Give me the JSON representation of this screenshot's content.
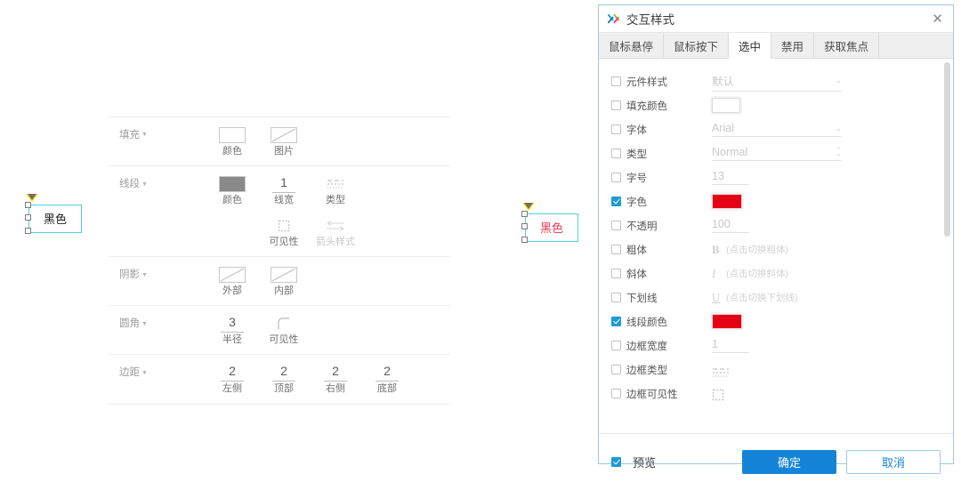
{
  "left_widget": {
    "label": "黑色",
    "text_color": "#1a1a1a",
    "selection_color": "#4fd2d8"
  },
  "right_widget": {
    "label": "黑色",
    "text_color": "#e8384f",
    "selection_color": "#4fd2d8"
  },
  "style_panel": {
    "rows": [
      {
        "label": "填充",
        "lines": [
          [
            {
              "caption": "颜色",
              "icon": "rect-swatch-icon",
              "kind": "swatch-white"
            },
            {
              "caption": "图片",
              "icon": "image-icon",
              "kind": "image"
            }
          ]
        ]
      },
      {
        "label": "线段",
        "lines": [
          [
            {
              "caption": "颜色",
              "icon": "line-color-swatch-icon",
              "kind": "swatch-gray"
            },
            {
              "caption": "线宽",
              "icon": "line-width-icon",
              "kind": "number",
              "value": "1"
            },
            {
              "caption": "类型",
              "icon": "line-type-icon",
              "kind": "dash"
            }
          ],
          [
            {
              "caption": "可见性",
              "icon": "visibility-icon",
              "kind": "visbox",
              "offset": 1
            },
            {
              "caption": "箭头样式",
              "icon": "arrow-style-icon",
              "kind": "arrow",
              "dim": true
            }
          ]
        ]
      },
      {
        "label": "阴影",
        "lines": [
          [
            {
              "caption": "外部",
              "icon": "outer-shadow-icon",
              "kind": "image"
            },
            {
              "caption": "内部",
              "icon": "inner-shadow-icon",
              "kind": "image"
            }
          ]
        ]
      },
      {
        "label": "圆角",
        "lines": [
          [
            {
              "caption": "半径",
              "icon": "corner-radius-icon",
              "kind": "number",
              "value": "3"
            },
            {
              "caption": "可见性",
              "icon": "corner-visibility-icon",
              "kind": "corner"
            }
          ]
        ]
      },
      {
        "label": "边距",
        "lines": [
          [
            {
              "caption": "左侧",
              "icon": "padding-left-icon",
              "kind": "number",
              "value": "2"
            },
            {
              "caption": "顶部",
              "icon": "padding-top-icon",
              "kind": "number",
              "value": "2"
            },
            {
              "caption": "右侧",
              "icon": "padding-right-icon",
              "kind": "number",
              "value": "2"
            },
            {
              "caption": "底部",
              "icon": "padding-bottom-icon",
              "kind": "number",
              "value": "2"
            }
          ]
        ]
      }
    ]
  },
  "dialog": {
    "title": "交互样式",
    "close_label": "✕",
    "tabs": [
      {
        "label": "鼠标悬停",
        "active": false
      },
      {
        "label": "鼠标按下",
        "active": false
      },
      {
        "label": "选中",
        "active": true
      },
      {
        "label": "禁用",
        "active": false
      },
      {
        "label": "获取焦点",
        "active": false
      }
    ],
    "accent_color": "#1584d8",
    "red_color": "#e60013",
    "rows": [
      {
        "label": "元件样式",
        "checked": false,
        "control": "select",
        "value": "默认"
      },
      {
        "label": "填充颜色",
        "checked": false,
        "control": "swatch-empty",
        "value": ""
      },
      {
        "label": "字体",
        "checked": false,
        "control": "select",
        "value": "Arial"
      },
      {
        "label": "类型",
        "checked": false,
        "control": "spinner",
        "value": "Normal"
      },
      {
        "label": "字号",
        "checked": false,
        "control": "number",
        "value": "13"
      },
      {
        "label": "字色",
        "checked": true,
        "control": "swatch-red",
        "value": "#e60013"
      },
      {
        "label": "不透明",
        "checked": false,
        "control": "number",
        "value": "100"
      },
      {
        "label": "粗体",
        "checked": false,
        "control": "toggle-bold",
        "glyph": "B",
        "hint": "(点击切换粗体)"
      },
      {
        "label": "斜体",
        "checked": false,
        "control": "toggle-italic",
        "glyph": "I",
        "hint": "(点击切换斜体)"
      },
      {
        "label": "下划线",
        "checked": false,
        "control": "toggle-underline",
        "glyph": "U",
        "hint": "(点击切换下划线)"
      },
      {
        "label": "线段颜色",
        "checked": true,
        "control": "swatch-red",
        "value": "#e60013"
      },
      {
        "label": "边框宽度",
        "checked": false,
        "control": "number",
        "value": "1"
      },
      {
        "label": "边框类型",
        "checked": false,
        "control": "dash",
        "value": ""
      },
      {
        "label": "边框可见性",
        "checked": false,
        "control": "visbox",
        "value": ""
      }
    ],
    "footer": {
      "preview_label": "预览",
      "preview_checked": true,
      "ok_label": "确定",
      "cancel_label": "取消"
    }
  }
}
